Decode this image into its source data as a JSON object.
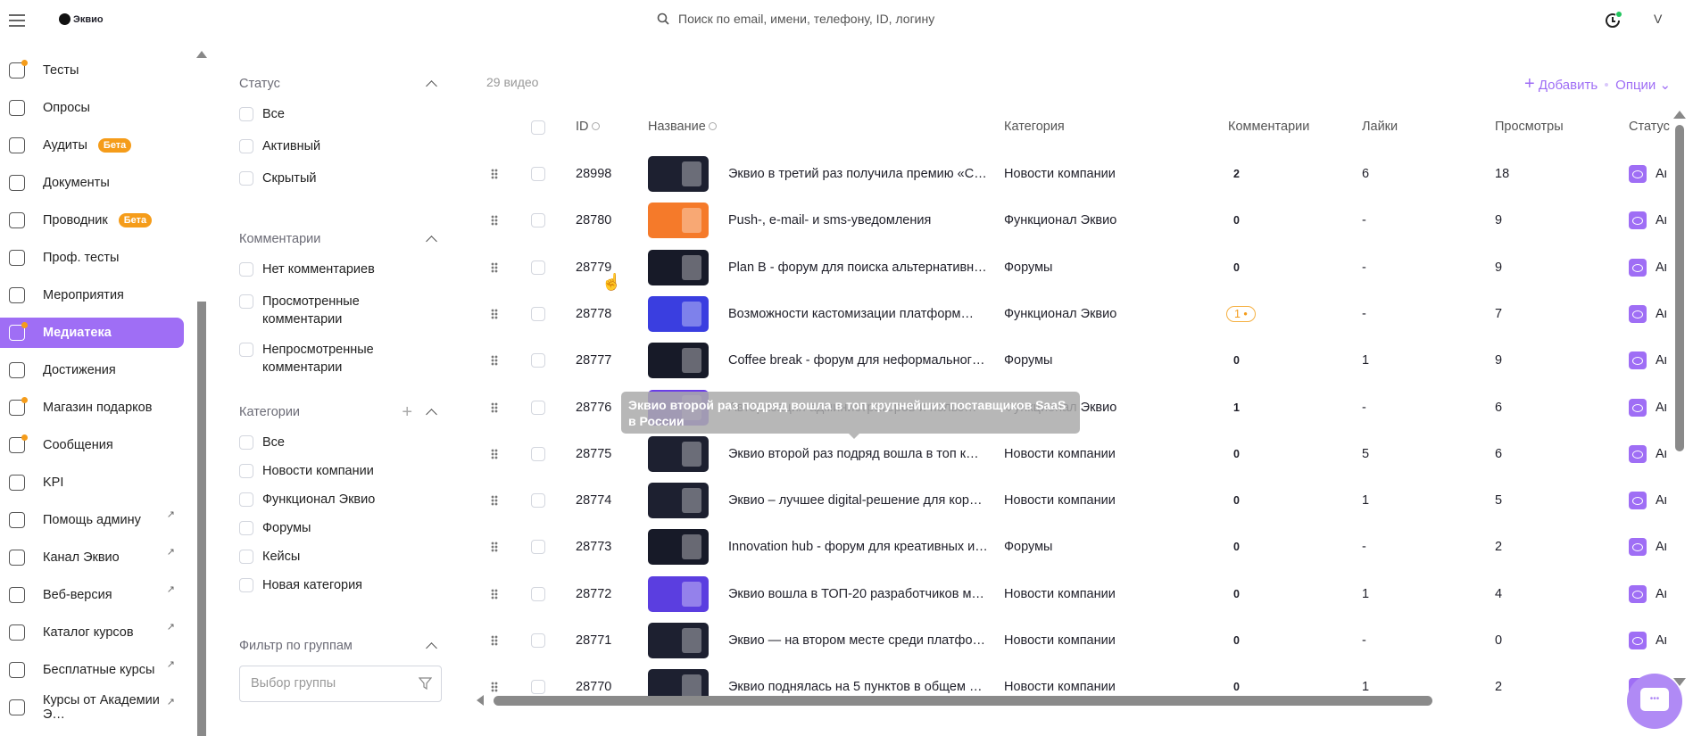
{
  "header": {
    "logo_text": "Эквио",
    "search_placeholder": "Поиск по email, имени, телефону, ID, логину",
    "avatar_initial": "V"
  },
  "sidebar": {
    "items": [
      {
        "label": "Тесты",
        "icon": "tests-icon",
        "dot": true
      },
      {
        "label": "Опросы",
        "icon": "survey-icon"
      },
      {
        "label": "Аудиты",
        "icon": "audit-icon",
        "badge": "Бета"
      },
      {
        "label": "Документы",
        "icon": "document-icon"
      },
      {
        "label": "Проводник",
        "icon": "folder-icon",
        "badge": "Бета"
      },
      {
        "label": "Проф. тесты",
        "icon": "user-check-icon"
      },
      {
        "label": "Мероприятия",
        "icon": "calendar-icon"
      },
      {
        "label": "Медиатека",
        "icon": "media-icon",
        "active": true,
        "dot": true
      },
      {
        "label": "Достижения",
        "icon": "trophy-icon"
      },
      {
        "label": "Магазин подарков",
        "icon": "gift-icon",
        "dot": true
      },
      {
        "label": "Сообщения",
        "icon": "message-icon",
        "dot": true
      },
      {
        "label": "KPI",
        "icon": "trend-icon"
      },
      {
        "label": "Помощь админу",
        "icon": "star-icon",
        "external": true
      },
      {
        "label": "Канал Эквио",
        "icon": "telegram-icon",
        "external": true
      },
      {
        "label": "Веб-версия",
        "icon": "monitor-icon",
        "external": true
      },
      {
        "label": "Каталог курсов",
        "icon": "external-link-icon",
        "external": true
      },
      {
        "label": "Бесплатные курсы",
        "icon": "external-link-icon",
        "external": true
      },
      {
        "label": "Курсы от Академии Э…",
        "icon": "external-link-icon",
        "external": true
      }
    ]
  },
  "filters": {
    "status": {
      "title": "Статус",
      "options": [
        "Все",
        "Активный",
        "Скрытый"
      ]
    },
    "comments": {
      "title": "Комментарии",
      "options": [
        "Нет комментариев",
        "Просмотренные комментарии",
        "Непросмотренные комментарии"
      ]
    },
    "categories": {
      "title": "Категории",
      "options": [
        "Все",
        "Новости компании",
        "Функционал Эквио",
        "Форумы",
        "Кейсы",
        "Новая категория"
      ]
    },
    "groups": {
      "title": "Фильтр по группам",
      "placeholder": "Выбор группы"
    }
  },
  "toolbar": {
    "count": "29 видео",
    "add_label": "Добавить",
    "options_label": "Опции"
  },
  "table": {
    "columns": {
      "id": "ID",
      "name": "Название",
      "category": "Категория",
      "comments": "Комментарии",
      "likes": "Лайки",
      "views": "Просмотры",
      "status": "Статус"
    },
    "rows": [
      {
        "id": "28998",
        "title": "Эквио в третий раз получила премию «С…",
        "category": "Новости компании",
        "comments": "2",
        "likes": "6",
        "views": "18",
        "status": "Ак",
        "thumb": "#1d2030"
      },
      {
        "id": "28780",
        "title": "Push-, e-mail- и sms-уведомления",
        "category": "Функционал Эквио",
        "comments": "0",
        "likes": "-",
        "views": "9",
        "status": "Ак",
        "thumb": "#f57a2a"
      },
      {
        "id": "28779",
        "title": "Plan B - форум для поиска альтернативн…",
        "category": "Форумы",
        "comments": "0",
        "likes": "-",
        "views": "9",
        "status": "Ак",
        "thumb": "#171a28"
      },
      {
        "id": "28778",
        "title": "Возможности кастомизации платформ…",
        "category": "Функционал Эквио",
        "comments": "1 •",
        "comments_badge": true,
        "likes": "-",
        "views": "7",
        "status": "Ак",
        "thumb": "#3a3ee0"
      },
      {
        "id": "28777",
        "title": "Coffee break - форум для неформальног…",
        "category": "Форумы",
        "comments": "0",
        "likes": "1",
        "views": "9",
        "status": "Ак",
        "thumb": "#171a28"
      },
      {
        "id": "28776",
        "title": "Авторизация администраторов и польз…",
        "category": "Функционал Эквио",
        "comments": "1",
        "likes": "-",
        "views": "6",
        "status": "Ак",
        "thumb": "#6a3ee8"
      },
      {
        "id": "28775",
        "title": "Эквио второй раз подряд вошла в топ к…",
        "category": "Новости компании",
        "comments": "0",
        "likes": "5",
        "views": "6",
        "status": "Ак",
        "thumb": "#1d2030"
      },
      {
        "id": "28774",
        "title": "Эквио – лучшее digital-решение для кор…",
        "category": "Новости компании",
        "comments": "0",
        "likes": "1",
        "views": "5",
        "status": "Ак",
        "thumb": "#1d2030"
      },
      {
        "id": "28773",
        "title": "Innovation hub - форум для креативных и…",
        "category": "Форумы",
        "comments": "0",
        "likes": "-",
        "views": "2",
        "status": "Ак",
        "thumb": "#171a28"
      },
      {
        "id": "28772",
        "title": "Эквио вошла в ТОП-20 разработчиков м…",
        "category": "Новости компании",
        "comments": "0",
        "likes": "1",
        "views": "4",
        "status": "Ак",
        "thumb": "#5b3ee0"
      },
      {
        "id": "28771",
        "title": "Эквио — на втором месте среди платфо…",
        "category": "Новости компании",
        "comments": "0",
        "likes": "-",
        "views": "0",
        "status": "Ак",
        "thumb": "#1d2030"
      },
      {
        "id": "28770",
        "title": "Эквио поднялась на 5 пунктов в общем …",
        "category": "Новости компании",
        "comments": "0",
        "likes": "1",
        "views": "2",
        "status": "Ак",
        "thumb": "#1d2030"
      }
    ]
  },
  "tooltip": "Эквио второй раз подряд вошла в топ крупнейших поставщиков SaaS в России",
  "colors": {
    "accent": "#9f6ef5",
    "badge": "#f59c1a"
  }
}
